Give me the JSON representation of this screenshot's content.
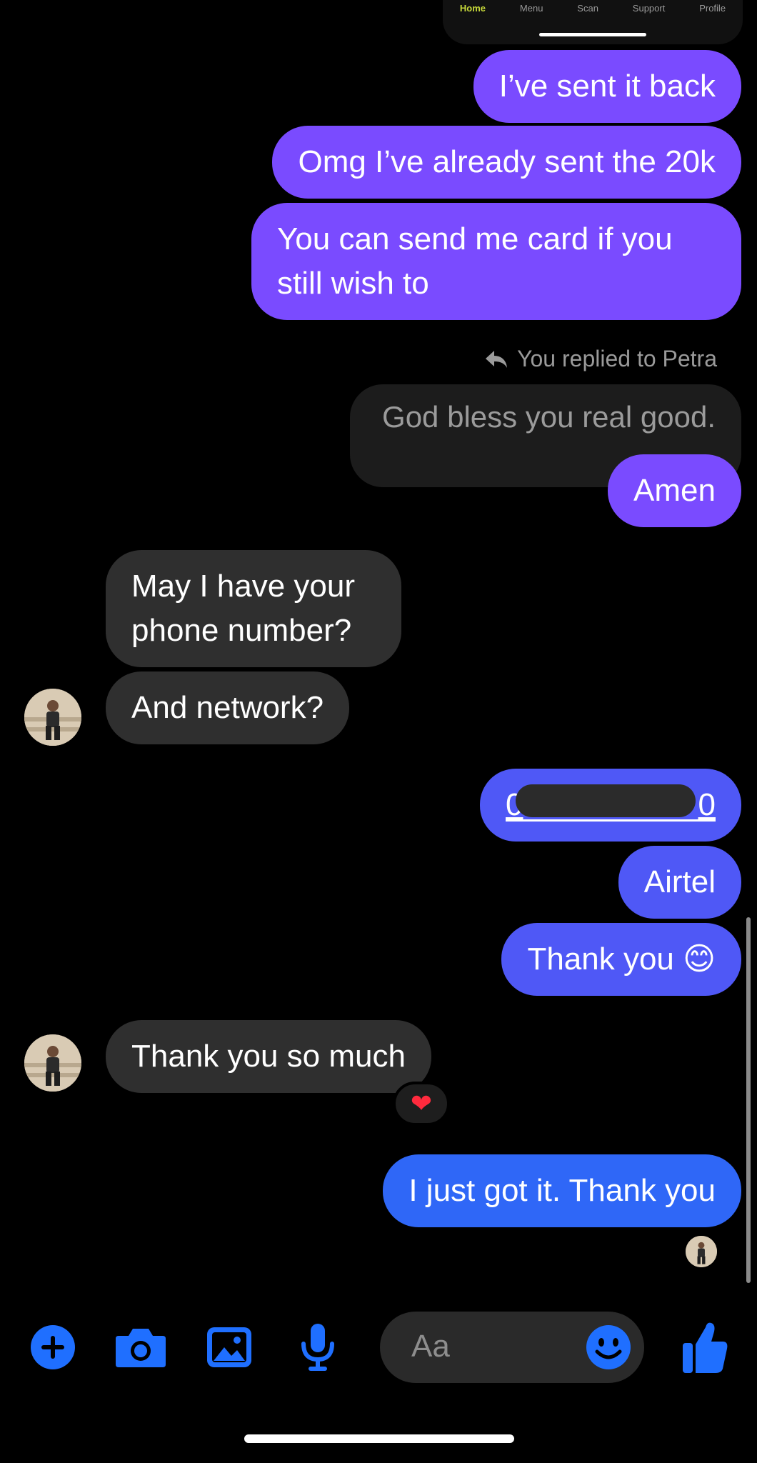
{
  "screenshot_nav": {
    "tabs": [
      "Home",
      "Menu",
      "Scan",
      "Support",
      "Profile"
    ],
    "active_tab": "Home",
    "accent": "#c6d83a"
  },
  "messages": {
    "m1": "I’ve sent it back",
    "m2": "Omg I’ve already sent the 20k",
    "m3": "You can send me card if you still wish to",
    "reply_meta": "You replied to Petra",
    "reply_quote": "God bless you real good.",
    "m4": "Amen",
    "m5": "May I have your phone number?",
    "m6": "And network?",
    "m7_start": "0",
    "m7_end": "0",
    "m8": "Airtel",
    "m9": "Thank you 😊",
    "m10": "Thank you so much",
    "reaction": "❤",
    "m11": "I just got it. Thank you"
  },
  "composer": {
    "placeholder": "Aa"
  },
  "colors": {
    "purple": "#7a4bff",
    "blue1": "#4f58f6",
    "blue2": "#2f67f7",
    "incoming": "#2f2f2f",
    "icon_blue": "#1f6fff"
  }
}
